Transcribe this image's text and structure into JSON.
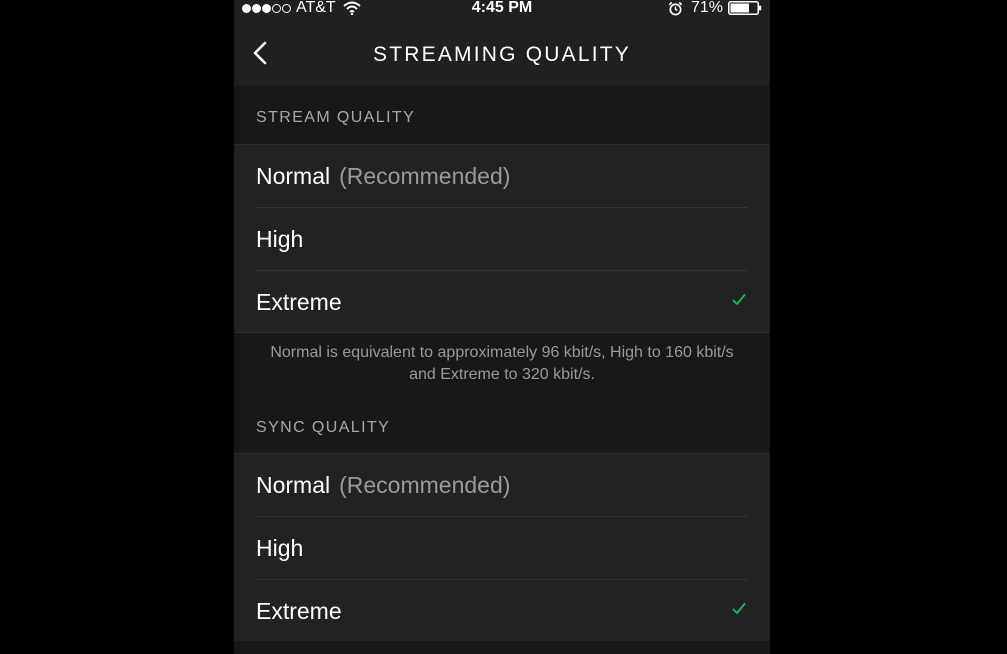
{
  "status_bar": {
    "carrier": "AT&T",
    "time": "4:45 PM",
    "battery": "71%",
    "signal_bars_filled": 3,
    "signal_bars_total": 5,
    "battery_level": 0.71
  },
  "nav": {
    "title": "STREAMING QUALITY",
    "back_icon": "chevron-left-icon"
  },
  "stream_quality": {
    "header": "STREAM QUALITY",
    "options": [
      {
        "label": "Normal",
        "hint": "(Recommended)",
        "selected": false
      },
      {
        "label": "High",
        "hint": "",
        "selected": false
      },
      {
        "label": "Extreme",
        "hint": "",
        "selected": true
      }
    ],
    "footnote": "Normal is equivalent to approximately 96 kbit/s, High to 160 kbit/s and Extreme to 320 kbit/s."
  },
  "sync_quality": {
    "header": "SYNC QUALITY",
    "options": [
      {
        "label": "Normal",
        "hint": "(Recommended)",
        "selected": false
      },
      {
        "label": "High",
        "hint": "",
        "selected": false
      },
      {
        "label": "Extreme",
        "hint": "",
        "selected": true
      }
    ]
  },
  "colors": {
    "accent_check": "#1db954",
    "background": "#181818",
    "row_background": "#222222",
    "text_primary": "#ffffff",
    "text_secondary": "#9a9a9a"
  }
}
